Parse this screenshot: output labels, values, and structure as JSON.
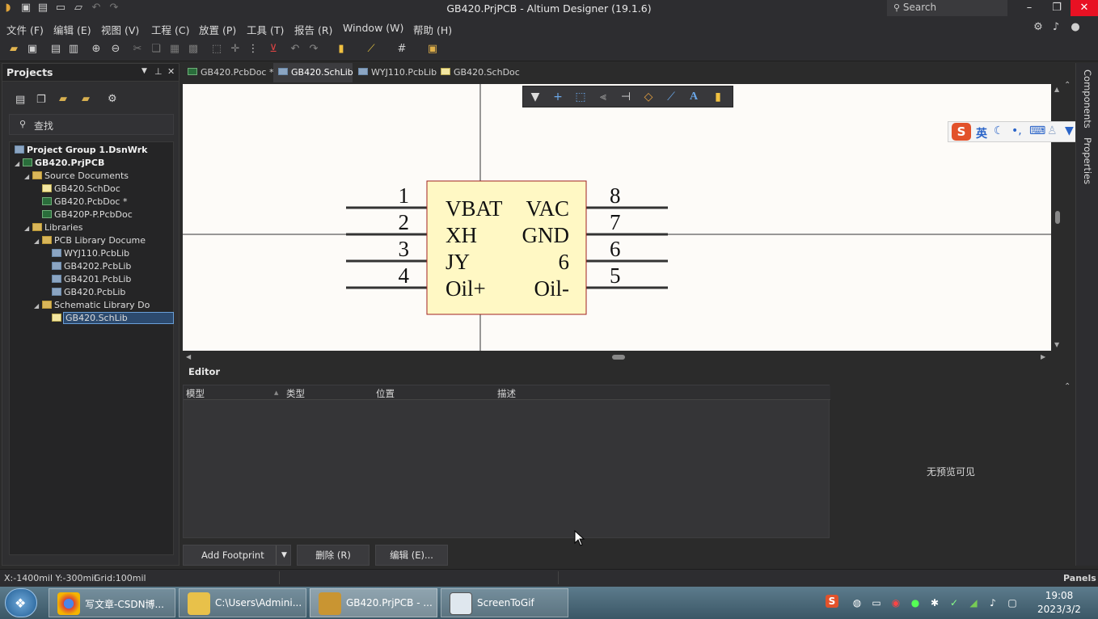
{
  "window": {
    "title": "GB420.PrjPCB - Altium Designer (19.1.6)",
    "search_placeholder": "Search"
  },
  "menu": [
    "文件 (F)",
    "编辑 (E)",
    "视图 (V)",
    "工程 (C)",
    "放置 (P)",
    "工具 (T)",
    "报告 (R)",
    "Window (W)",
    "帮助 (H)"
  ],
  "projects": {
    "title": "Projects",
    "search_label": "查找",
    "tree": [
      {
        "label": "Project Group 1.DsnWrk",
        "level": 0,
        "icon": "workspace-icon",
        "bold": true
      },
      {
        "label": "GB420.PrjPCB",
        "level": 1,
        "icon": "pcb-project-icon",
        "bold": true,
        "arrow": "open"
      },
      {
        "label": "Source Documents",
        "level": 2,
        "icon": "folder-icon",
        "arrow": "open"
      },
      {
        "label": "GB420.SchDoc",
        "level": 3,
        "icon": "schdoc-icon"
      },
      {
        "label": "GB420.PcbDoc *",
        "level": 3,
        "icon": "pcbdoc-icon"
      },
      {
        "label": "GB420P-P.PcbDoc",
        "level": 3,
        "icon": "pcbdoc-icon"
      },
      {
        "label": "Libraries",
        "level": 2,
        "icon": "folder-icon",
        "arrow": "open"
      },
      {
        "label": "PCB Library Docume",
        "level": 3,
        "icon": "folder-icon",
        "arrow": "open"
      },
      {
        "label": "WYJ110.PcbLib",
        "level": 4,
        "icon": "pcblib-icon"
      },
      {
        "label": "GB4202.PcbLib",
        "level": 4,
        "icon": "pcblib-icon"
      },
      {
        "label": "GB4201.PcbLib",
        "level": 4,
        "icon": "pcblib-icon"
      },
      {
        "label": "GB420.PcbLib",
        "level": 4,
        "icon": "pcblib-icon"
      },
      {
        "label": "Schematic Library Do",
        "level": 3,
        "icon": "folder-icon",
        "arrow": "open"
      },
      {
        "label": "GB420.SchLib",
        "level": 4,
        "icon": "schlib-icon",
        "selected": true
      }
    ]
  },
  "tabs": [
    {
      "label": "GB420.PcbDoc *",
      "icon": "pcbdoc-icon",
      "active": false
    },
    {
      "label": "GB420.SchLib",
      "icon": "schlib-icon",
      "active": true
    },
    {
      "label": "WYJ110.PcbLib",
      "icon": "pcblib-icon",
      "active": false
    },
    {
      "label": "GB420.SchDoc",
      "icon": "schdoc-icon",
      "active": false
    }
  ],
  "component": {
    "pin_numbers_left": [
      "1",
      "2",
      "3",
      "4"
    ],
    "pin_numbers_right": [
      "8",
      "7",
      "6",
      "5"
    ],
    "labels_left": [
      "VBAT",
      "XH",
      "JY",
      "Oil+"
    ],
    "labels_right": [
      "VAC",
      "GND",
      "6",
      "Oil-"
    ],
    "body_color": "#fff8c4",
    "border_color": "#a02020"
  },
  "side_panels": [
    "Components",
    "Properties"
  ],
  "ime": {
    "logo": "S",
    "mode": "英"
  },
  "editor": {
    "title": "Editor",
    "columns": [
      "模型",
      "类型",
      "位置",
      "描述"
    ],
    "preview_text": "无预览可见",
    "buttons": {
      "add": "Add Footprint",
      "delete": "删除 (R)",
      "edit": "编辑 (E)..."
    }
  },
  "status": {
    "coords": "X:-1400mil Y:-300mil",
    "grid": "Grid:100mil",
    "panels": "Panels"
  },
  "taskbar": {
    "items": [
      "写文章-CSDN博...",
      "C:\\Users\\Admini...",
      "GB420.PrjPCB - ...",
      "ScreenToGif"
    ],
    "time": "19:08",
    "date": "2023/3/2"
  }
}
